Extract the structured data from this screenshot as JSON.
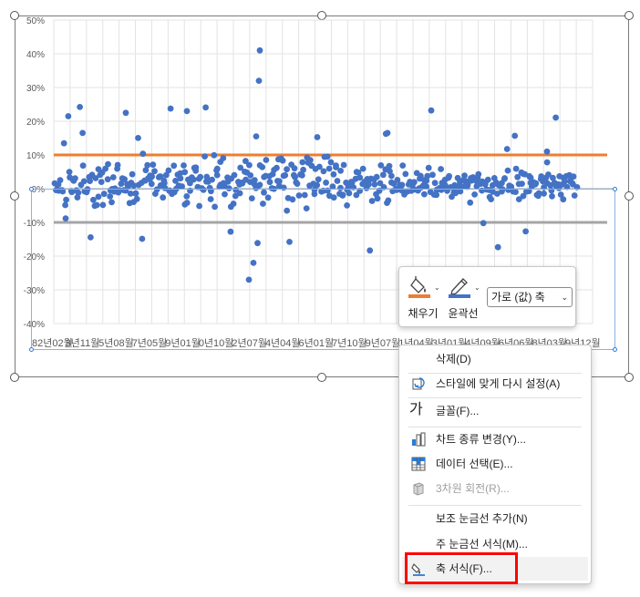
{
  "chart_data": {
    "type": "scatter",
    "y_tick_labels": [
      "50%",
      "40%",
      "30%",
      "20%",
      "10%",
      "0%",
      "-10%",
      "-20%",
      "-30%",
      "-40%"
    ],
    "y_ticks": [
      0.5,
      0.4,
      0.3,
      0.2,
      0.1,
      0,
      -0.1,
      -0.2,
      -0.3,
      -0.4
    ],
    "ylim": [
      -0.4,
      0.5
    ],
    "x_tick_labels": [
      "82년02월",
      "3년11월",
      "5년08월",
      "7년05월",
      "9년01월",
      "0년10월",
      "2년07월",
      "4년04월",
      "6년01월",
      "7년10월",
      "9년07월",
      "1년04월",
      "3년01월",
      "4년09월",
      "6년06월",
      "8년03월",
      "9년12월"
    ],
    "grid": true,
    "reference_lines": [
      {
        "value": 0.1,
        "color": "#ED7D31"
      },
      {
        "value": -0.1,
        "color": "#A5A5A5"
      }
    ],
    "marker_color": "#4472C4",
    "point_count": 480,
    "seed": 20240501
  },
  "mini_toolbar": {
    "fill_label": "채우기",
    "outline_label": "윤곽선",
    "fill_color": "#ED7D31",
    "outline_color": "#4472C4",
    "axis_select_value": "가로 (값) 축"
  },
  "context_menu": {
    "items": [
      {
        "label": "삭제(D)",
        "icon": "none"
      },
      {
        "label": "스타일에 맞게 다시 설정(A)",
        "icon": "reset-style-icon"
      },
      {
        "label": "글꼴(F)...",
        "icon": "font-icon",
        "icon_text": "가"
      },
      {
        "label": "차트 종류 변경(Y)...",
        "icon": "chart-type-icon"
      },
      {
        "label": "데이터 선택(E)...",
        "icon": "select-data-icon"
      },
      {
        "label": "3차원 회전(R)...",
        "icon": "3d-rotation-icon",
        "disabled": true
      },
      {
        "label": "보조 눈금선 추가(N)",
        "icon": "none"
      },
      {
        "label": "주 눈금선 서식(M)...",
        "icon": "none"
      },
      {
        "label": "축 서식(F)...",
        "icon": "format-axis-icon"
      }
    ]
  }
}
